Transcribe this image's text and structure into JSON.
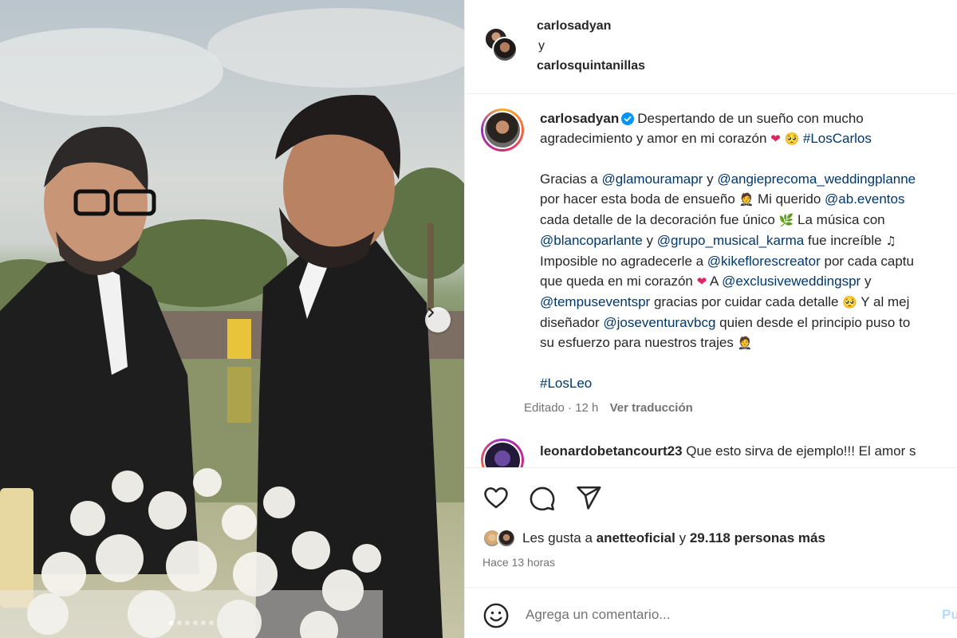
{
  "header": {
    "user1": "carlosadyan",
    "connector": "y",
    "user2": "carlosquintanillas"
  },
  "caption": {
    "username": "carlosadyan",
    "line1": "Despertando de un sueño con mucho",
    "line2_text": "agradecimiento y amor en mi corazón",
    "line2_tag": "#LosCarlos",
    "p2": [
      [
        {
          "t": "Gracias a "
        },
        {
          "tag": "@glamouramapr"
        },
        {
          "t": " y "
        },
        {
          "tag": "@angieprecoma_weddingplanne"
        }
      ],
      [
        {
          "t": "por hacer esta boda de ensueño "
        },
        {
          "e": "🤵"
        },
        {
          "t": "  Mi querido "
        },
        {
          "tag": "@ab.eventos"
        }
      ],
      [
        {
          "t": "cada detalle de la decoración fue único "
        },
        {
          "e": "🌿"
        },
        {
          "t": "  La música con"
        }
      ],
      [
        {
          "tag": "@blancoparlante"
        },
        {
          "t": " y "
        },
        {
          "tag": "@grupo_musical_karma"
        },
        {
          "t": " fue increíble "
        },
        {
          "e": "♫"
        }
      ],
      [
        {
          "t": "Imposible no agradecerle a "
        },
        {
          "tag": "@kikeflorescreator"
        },
        {
          "t": " por cada captu"
        }
      ],
      [
        {
          "t": "que queda en mi corazón "
        },
        {
          "e": "❤",
          "heart": true
        },
        {
          "t": "  A "
        },
        {
          "tag": "@exclusiveweddingspr"
        },
        {
          "t": " y"
        }
      ],
      [
        {
          "tag": "@tempuseventspr"
        },
        {
          "t": " gracias por cuidar cada detalle "
        },
        {
          "e": "🥺"
        },
        {
          "t": "  Y al mej"
        }
      ],
      [
        {
          "t": "diseñador "
        },
        {
          "tag": "@joseventuravbcg"
        },
        {
          "t": " quien desde el principio puso to"
        }
      ],
      [
        {
          "t": "su esfuerzo para nuestros trajes "
        },
        {
          "e": "🤵"
        }
      ]
    ],
    "footer_tag": "#LosLeo",
    "edited": "Editado · 12 h",
    "translate": "Ver traducción"
  },
  "comment": {
    "username": "leonardobetancourt23",
    "text": "Que esto sirva de ejemplo!!! El amor s"
  },
  "likes": {
    "prefix": "Les gusta a",
    "user": "anetteoficial",
    "connector": "y",
    "count": "29.118 personas más"
  },
  "time_ago": "Hace 13 horas",
  "add_comment": {
    "placeholder": "Agrega un comentario...",
    "post_label": "Pu"
  },
  "carousel": {
    "slides": 6,
    "active_index": 0
  },
  "colors": {
    "link": "#00376b",
    "muted": "#737373",
    "text": "#262626",
    "heart": "#e0245e",
    "verified": "#0095f6"
  }
}
